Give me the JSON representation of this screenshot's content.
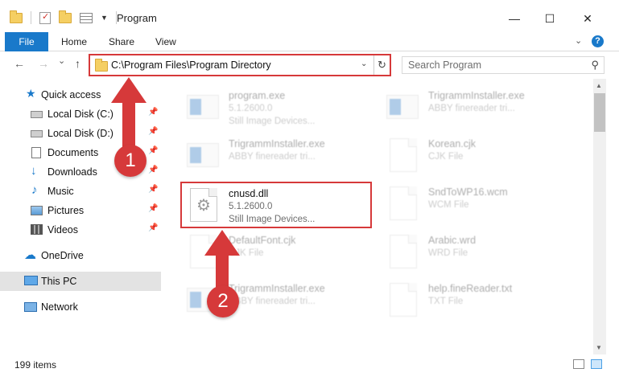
{
  "window": {
    "title": "Program",
    "minimize": "—",
    "maximize": "☐",
    "close": "✕"
  },
  "ribbon": {
    "file": "File",
    "home": "Home",
    "share": "Share",
    "view": "View",
    "help": "?"
  },
  "nav": {
    "back": "←",
    "forward": "→",
    "recent": "⌄",
    "up": "↑",
    "address": "C:\\Program Files\\Program Directory",
    "search_placeholder": "Search Program"
  },
  "sidebar": {
    "items": [
      {
        "label": "Quick access"
      },
      {
        "label": "Local Disk (C:)"
      },
      {
        "label": "Local Disk (D:)"
      },
      {
        "label": "Documents"
      },
      {
        "label": "Downloads"
      },
      {
        "label": "Music"
      },
      {
        "label": "Pictures"
      },
      {
        "label": "Videos"
      },
      {
        "label": "OneDrive"
      },
      {
        "label": "This PC"
      },
      {
        "label": "Network"
      }
    ]
  },
  "files": [
    {
      "name": "program.exe",
      "line2": "5.1.2600.0",
      "line3": "Still Image Devices..."
    },
    {
      "name": "TrigrammInstaller.exe",
      "line2": "ABBY finereader tri...",
      "line3": ""
    },
    {
      "name": "TrigrammInstaller.exe",
      "line2": "ABBY finereader tri...",
      "line3": ""
    },
    {
      "name": "Korean.cjk",
      "line2": "CJK File",
      "line3": ""
    },
    {
      "name": "cnusd.dll",
      "line2": "5.1.2600.0",
      "line3": "Still Image Devices..."
    },
    {
      "name": "SndToWP16.wcm",
      "line2": "WCM File",
      "line3": ""
    },
    {
      "name": "DefaultFont.cjk",
      "line2": "CJK File",
      "line3": ""
    },
    {
      "name": "Arabic.wrd",
      "line2": "WRD File",
      "line3": ""
    },
    {
      "name": "TrigrammInstaller.exe",
      "line2": "ABBY finereader tri...",
      "line3": ""
    },
    {
      "name": "help.fineReader.txt",
      "line2": "TXT File",
      "line3": ""
    }
  ],
  "badges": {
    "one": "1",
    "two": "2"
  },
  "status": {
    "items": "199 items"
  },
  "colors": {
    "accent": "#1979ca",
    "highlight": "#d6393a",
    "selected": "#e3e3e3"
  }
}
